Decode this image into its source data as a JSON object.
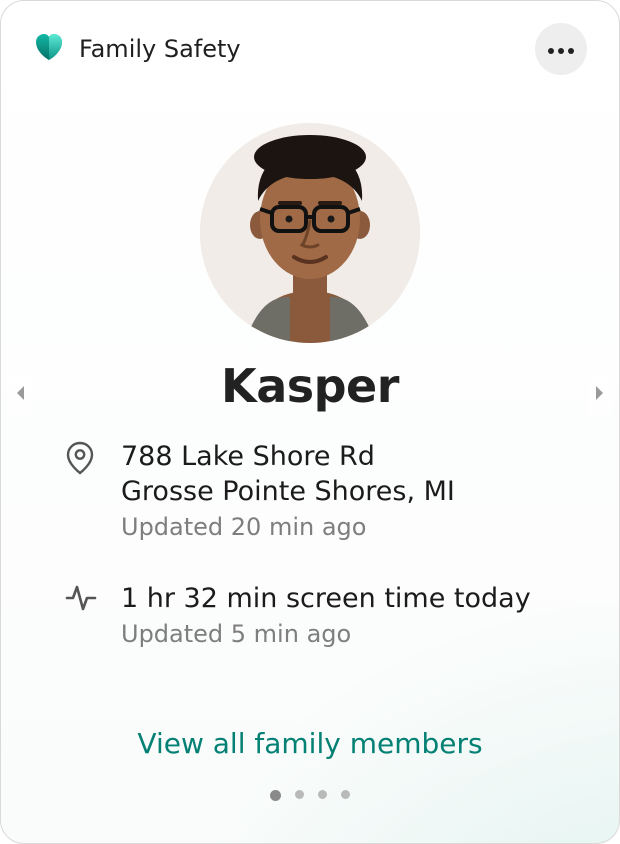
{
  "header": {
    "app_title": "Family Safety",
    "icon": "heart-shield-icon",
    "more_icon": "ellipsis-icon"
  },
  "member": {
    "name": "Kasper",
    "avatar_alt": "Photo of Kasper"
  },
  "location": {
    "icon": "location-pin-icon",
    "line1": "788 Lake Shore Rd",
    "line2": "Grosse Pointe Shores, MI",
    "updated": "Updated 20 min ago"
  },
  "screen_time": {
    "icon": "activity-icon",
    "summary": "1 hr 32 min screen time today",
    "updated": "Updated 5 min ago"
  },
  "footer": {
    "view_all_label": "View all family members"
  },
  "pagination": {
    "count": 4,
    "active_index": 0
  },
  "colors": {
    "accent": "#058074",
    "text_primary": "#1f1f1f",
    "text_muted": "#7e7e7e"
  }
}
